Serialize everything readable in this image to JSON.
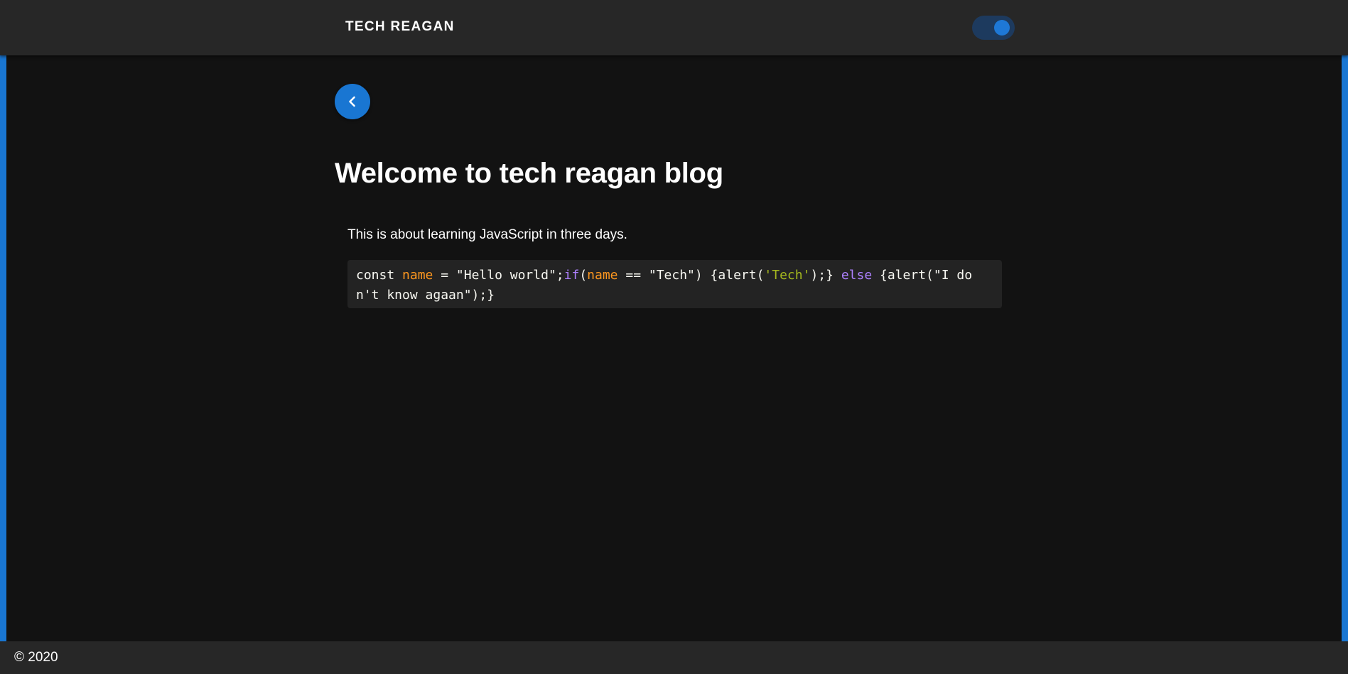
{
  "header": {
    "brand": "TECH REAGAN",
    "theme_toggle_state": "on",
    "accent_color": "#1976d2"
  },
  "post": {
    "title": "Welcome to tech reagan blog",
    "intro": "This is about learning JavaScript in three days.",
    "code": {
      "t1": "const ",
      "t2": "name",
      "t3": " = \"Hello world\";",
      "t4": "if",
      "t5": "(",
      "t6": "name",
      "t7": " == \"Tech\") {alert(",
      "t8": "'Tech'",
      "t9": ");} ",
      "t10": "else",
      "t11": " {alert(\"I don't know agaan\");}"
    }
  },
  "footer": {
    "copyright": "© 2020"
  },
  "icons": {
    "back": "chevron-left-icon"
  }
}
